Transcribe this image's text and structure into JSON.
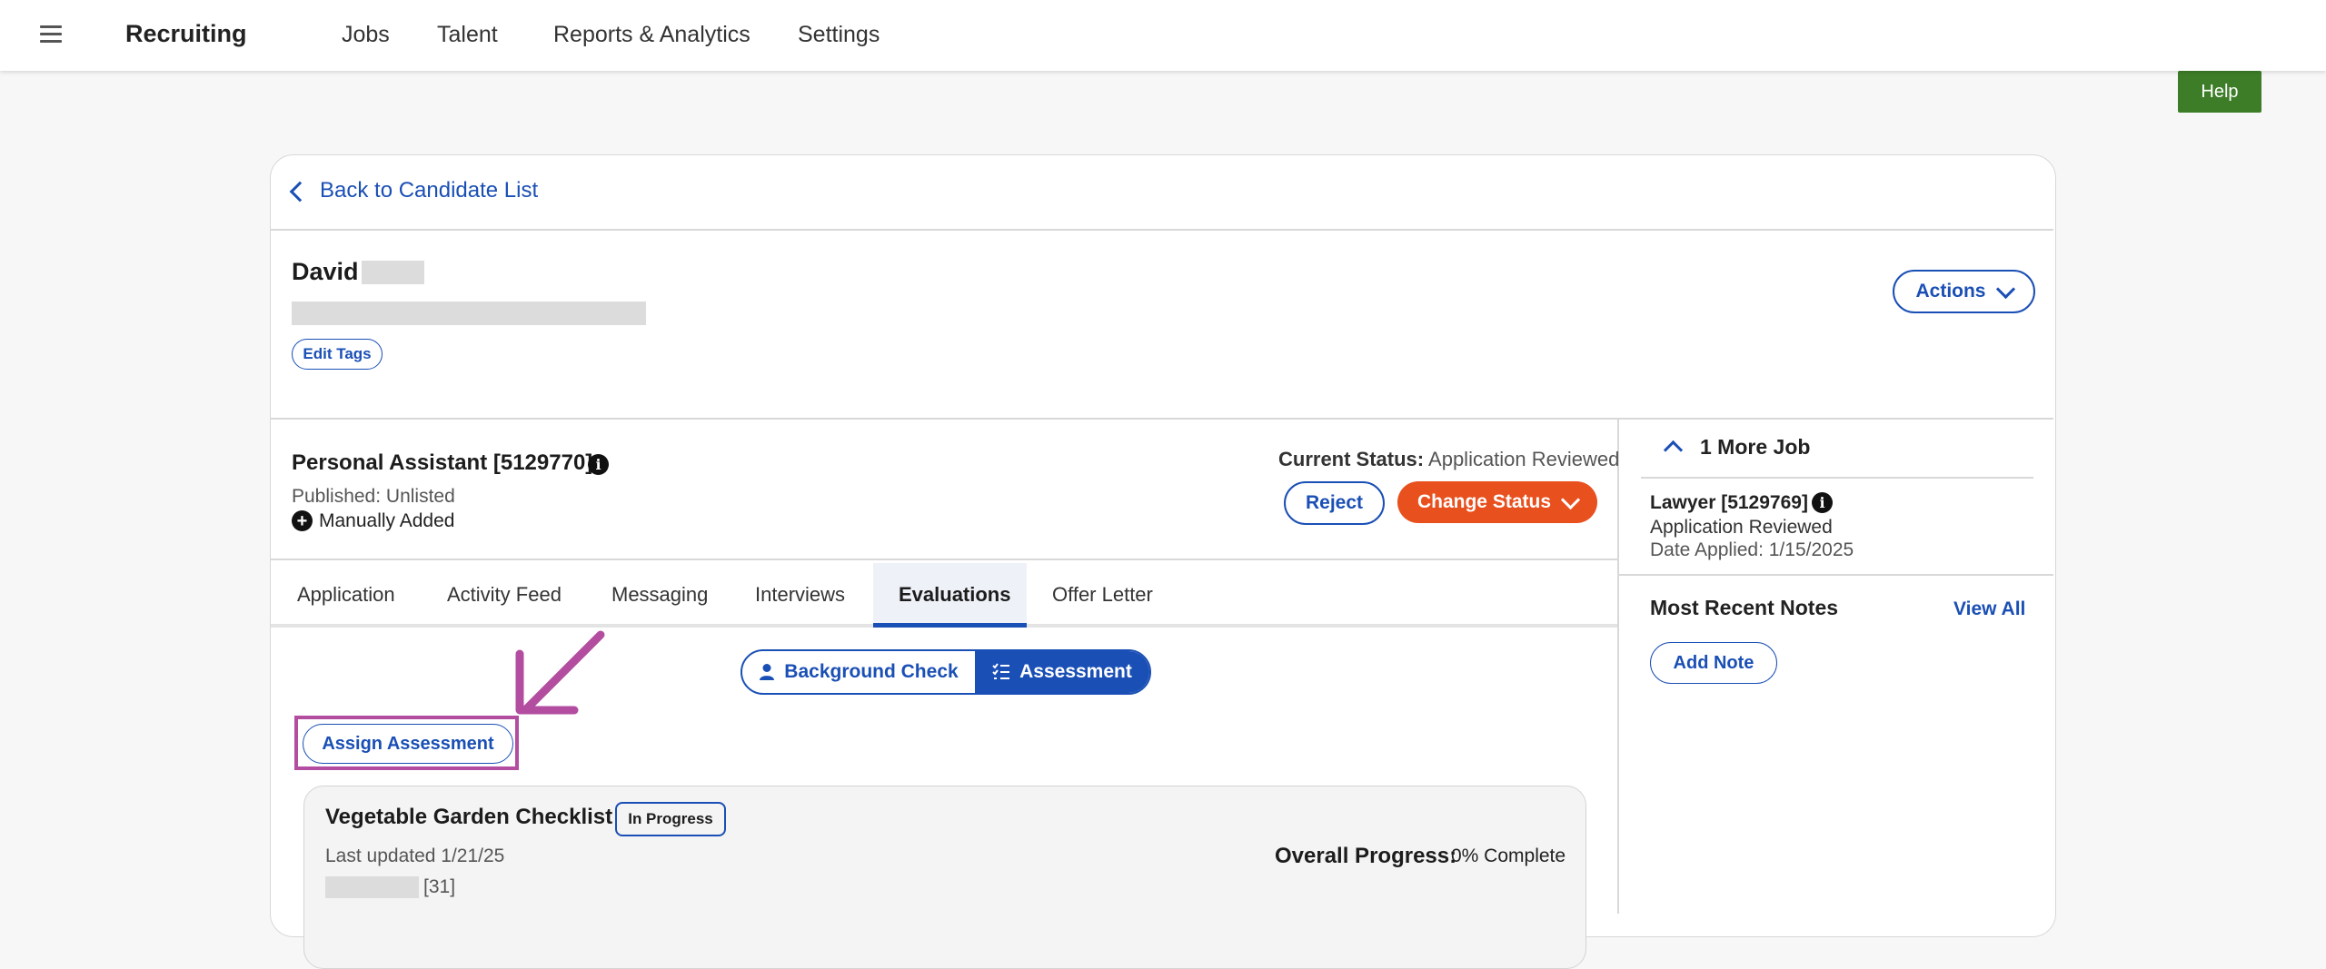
{
  "app": {
    "brand": "Recruiting"
  },
  "nav": {
    "items": [
      "Jobs",
      "Talent",
      "Reports & Analytics",
      "Settings"
    ]
  },
  "help": {
    "label": "Help"
  },
  "back": {
    "label": "Back to Candidate List"
  },
  "candidate": {
    "first_name": "David",
    "edit_tags_label": "Edit Tags",
    "actions_label": "Actions"
  },
  "job": {
    "title": "Personal Assistant [5129770]",
    "published": "Published: Unlisted",
    "added": "Manually Added",
    "status_label": "Current Status:",
    "status_value": "Application Reviewed",
    "reject_label": "Reject",
    "change_status_label": "Change Status"
  },
  "tabs": {
    "items": [
      "Application",
      "Activity Feed",
      "Messaging",
      "Interviews",
      "Evaluations",
      "Offer Letter"
    ],
    "active": "Evaluations"
  },
  "toggle": {
    "background_check": "Background Check",
    "assessment": "Assessment",
    "selected": "Assessment"
  },
  "assign": {
    "label": "Assign Assessment"
  },
  "evaluation": {
    "title": "Vegetable Garden Checklist",
    "badge": "In Progress",
    "last_updated": "Last updated 1/21/25",
    "id_suffix": "[31]",
    "progress_label": "Overall Progress:",
    "progress_value": "0% Complete"
  },
  "sidebar": {
    "more_jobs": "1 More Job",
    "other_job": {
      "title": "Lawyer [5129769]",
      "status": "Application Reviewed",
      "date": "Date Applied: 1/15/2025"
    },
    "notes_title": "Most Recent Notes",
    "view_all": "View All",
    "add_note": "Add Note"
  },
  "colors": {
    "link_blue": "#1a4fb5",
    "help_green": "#3d7d28",
    "change_status_orange": "#e8501e",
    "annotation_magenta": "#b24da0"
  }
}
